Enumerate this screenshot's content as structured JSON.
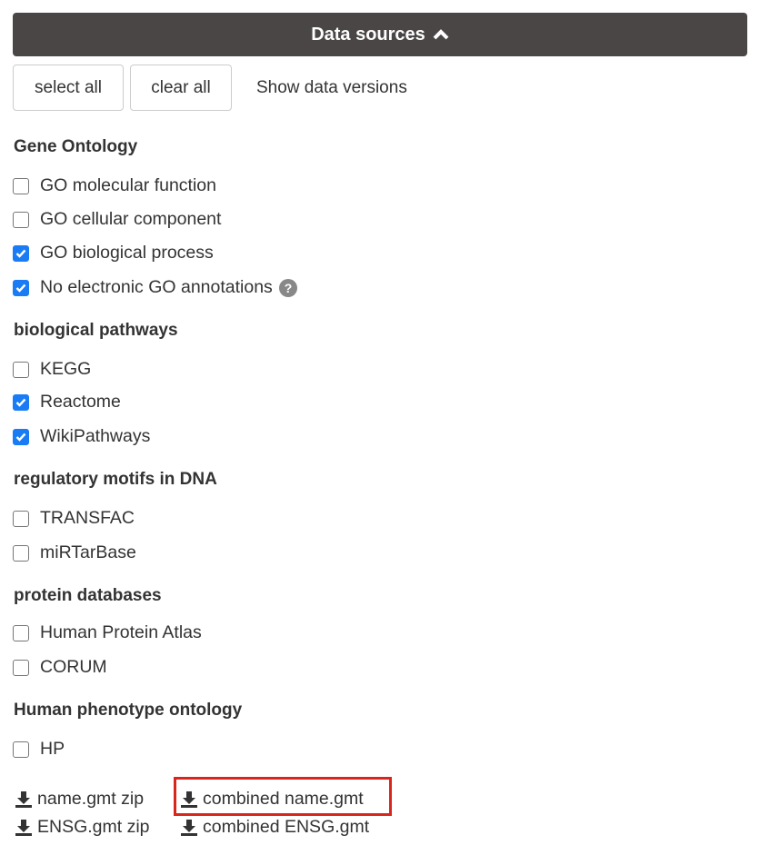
{
  "header": {
    "title": "Data sources",
    "icon": "chevron-up-icon"
  },
  "toolbar": {
    "select_all": "select all",
    "clear_all": "clear all",
    "show_versions": "Show data versions"
  },
  "sections": [
    {
      "title": "Gene Ontology",
      "items": [
        {
          "label": "GO molecular function",
          "checked": false
        },
        {
          "label": "GO cellular component",
          "checked": false
        },
        {
          "label": "GO biological process",
          "checked": true
        },
        {
          "label": "No electronic GO annotations",
          "checked": true,
          "help_icon": "question-circle-icon"
        }
      ]
    },
    {
      "title": "biological pathways",
      "items": [
        {
          "label": "KEGG",
          "checked": false
        },
        {
          "label": "Reactome",
          "checked": true
        },
        {
          "label": "WikiPathways",
          "checked": true
        }
      ]
    },
    {
      "title": "regulatory motifs in DNA",
      "items": [
        {
          "label": "TRANSFAC",
          "checked": false
        },
        {
          "label": "miRTarBase",
          "checked": false
        }
      ]
    },
    {
      "title": "protein databases",
      "items": [
        {
          "label": "Human Protein Atlas",
          "checked": false
        },
        {
          "label": "CORUM",
          "checked": false
        }
      ]
    },
    {
      "title": "Human phenotype ontology",
      "items": [
        {
          "label": "HP",
          "checked": false
        }
      ]
    }
  ],
  "downloads": [
    {
      "label": "name.gmt zip",
      "icon": "download-icon"
    },
    {
      "label": "combined name.gmt",
      "icon": "download-icon",
      "highlighted": true
    },
    {
      "label": "ENSG.gmt zip",
      "icon": "download-icon"
    },
    {
      "label": "combined ENSG.gmt",
      "icon": "download-icon"
    }
  ],
  "colors": {
    "header_bg": "#4a4645",
    "checkbox_checked": "#1a7cf5",
    "highlight": "#d9261c"
  }
}
